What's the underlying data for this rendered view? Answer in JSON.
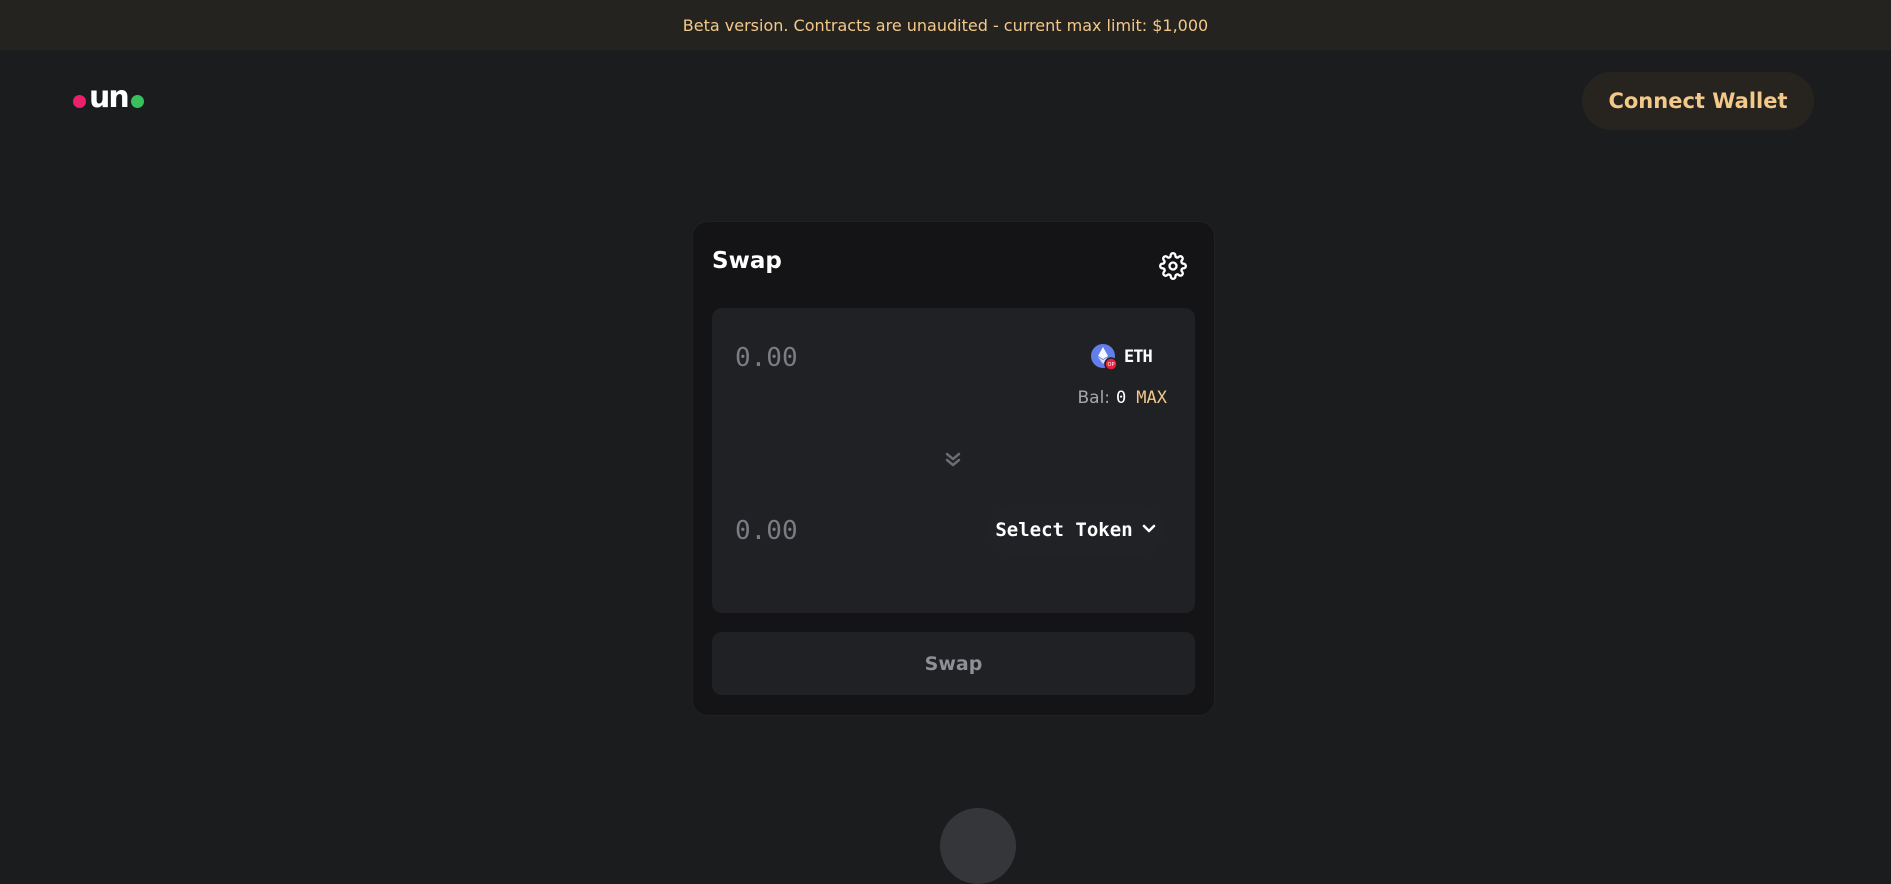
{
  "banner": {
    "text": "Beta version. Contracts are unaudited - current max limit: $1,000"
  },
  "header": {
    "logo_text": "un",
    "connect_wallet_label": "Connect Wallet"
  },
  "swap_card": {
    "title": "Swap",
    "settings_icon": "gear-icon",
    "from": {
      "amount_placeholder": "0.00",
      "token_symbol": "ETH",
      "token_icon": "eth-icon",
      "balance_label": "Bal:",
      "balance_value": "0",
      "max_label": "MAX"
    },
    "direction_icon": "double-chevron-down-icon",
    "to": {
      "amount_placeholder": "0.00",
      "select_token_label": "Select Token",
      "select_icon": "chevron-down-icon"
    },
    "swap_button_label": "Swap"
  },
  "colors": {
    "background": "#1b1c1e",
    "banner_bg": "#25231f",
    "accent": "#f3c98b",
    "card_bg": "#141416",
    "panel_bg": "#202124",
    "logo_pink": "#e8216b",
    "logo_green": "#37c05c",
    "eth_blue": "#627eea",
    "eth_badge_red": "#e8213b"
  }
}
